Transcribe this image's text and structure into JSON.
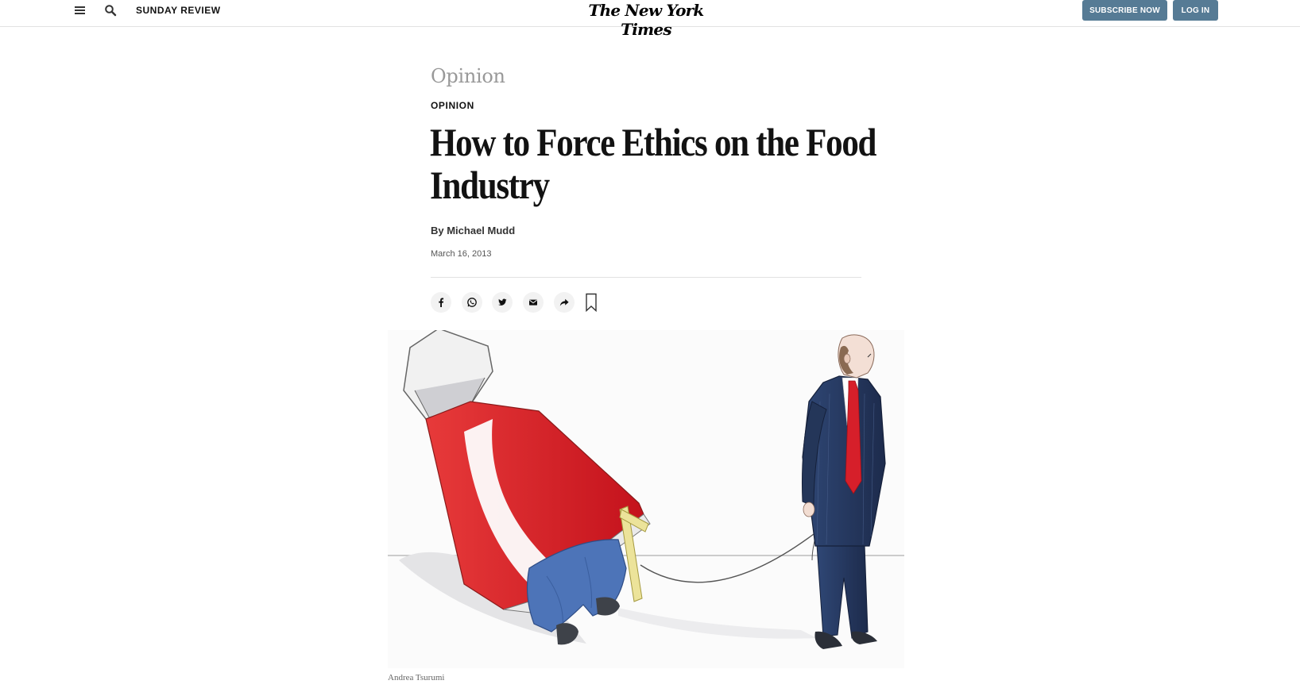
{
  "header": {
    "section_label": "SUNDAY REVIEW",
    "logo_text": "The New York Times",
    "subscribe_label": "SUBSCRIBE NOW",
    "login_label": "LOG IN"
  },
  "article": {
    "kicker": "Opinion",
    "section_tag": "OPINION",
    "headline_lines": [
      "How to Force Ethics on the Food",
      "Industry"
    ],
    "byline": "By Michael Mudd",
    "date": "March 16, 2013"
  },
  "share_tools": [
    "facebook-icon",
    "whatsapp-icon",
    "twitter-icon",
    "email-icon",
    "share-arrow-icon",
    "bookmark-icon"
  ],
  "illustration": {
    "credit": "Andrea Tsurumi"
  },
  "colors": {
    "button_bg": "#567b95",
    "ketchup_red": "#d9202a",
    "suit_navy": "#243659",
    "tie_red": "#d61f2a",
    "jeans_blue": "#4d74b8"
  }
}
